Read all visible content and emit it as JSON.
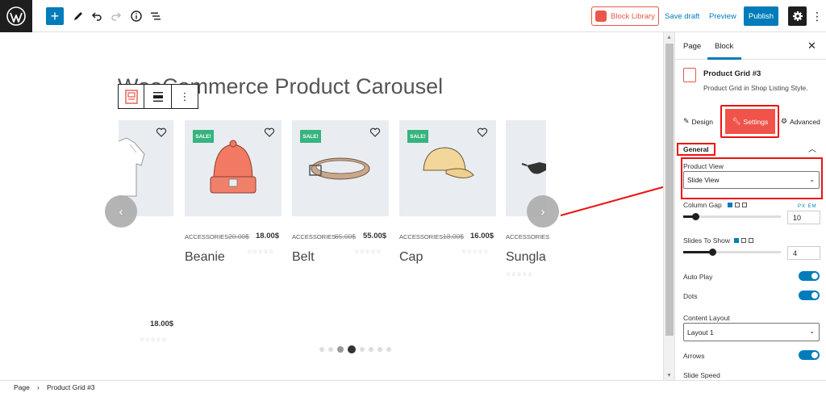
{
  "topbar": {
    "add_label": "+",
    "block_library": "Block Library",
    "save_draft": "Save draft",
    "preview": "Preview",
    "publish": "Publish",
    "more": "⋮"
  },
  "block_toolbar": {
    "more": "⋮"
  },
  "page": {
    "title_prefix": "WooCommerce",
    "title_underlined": "merce",
    "title_main": "WooCommerce Product Carousel"
  },
  "products": [
    {
      "category": "",
      "old_price": "",
      "price": "18.00$",
      "name": "",
      "sale": ""
    },
    {
      "category": "ACCESSORIES",
      "old_price": "20.00$",
      "price": "18.00$",
      "name": "Beanie",
      "sale": "SALE!"
    },
    {
      "category": "ACCESSORIES",
      "old_price": "65.00$",
      "price": "55.00$",
      "name": "Belt",
      "sale": "SALE!"
    },
    {
      "category": "ACCESSORIES",
      "old_price": "18.00$",
      "price": "16.00$",
      "name": "Cap",
      "sale": "SALE!"
    },
    {
      "category": "ACCESSORIES",
      "old_price": "",
      "price": "",
      "name": "Sungla",
      "sale": ""
    }
  ],
  "stars": "☆☆☆☆☆",
  "carousel": {
    "prev": "‹",
    "next": "›",
    "dot_count": 8,
    "active_dot": 3
  },
  "sidebar": {
    "tab_page": "Page",
    "tab_block": "Block",
    "close": "✕",
    "block_title": "Product Grid #3",
    "block_desc": "Product Grid in Shop Listing Style.",
    "tab_design": "Design",
    "tab_settings": "Settings",
    "tab_advanced": "Advanced",
    "section_general": "General",
    "product_view_label": "Product View",
    "product_view_value": "Slide View",
    "column_gap_label": "Column Gap",
    "column_gap_value": "10",
    "units": "PX  EM",
    "slides_to_show_label": "Slides To Show",
    "slides_to_show_value": "4",
    "auto_play_label": "Auto Play",
    "dots_label": "Dots",
    "content_layout_label": "Content Layout",
    "content_layout_value": "Layout 1",
    "arrows_label": "Arrows",
    "slide_speed_label": "Slide Speed"
  },
  "footer": {
    "crumb_page": "Page",
    "crumb_sep": "›",
    "crumb_block": "Product Grid #3"
  },
  "colors": {
    "accent": "#007cba",
    "brand": "#e8584a",
    "highlight": "#ee1111",
    "sale": "#36b37e"
  }
}
